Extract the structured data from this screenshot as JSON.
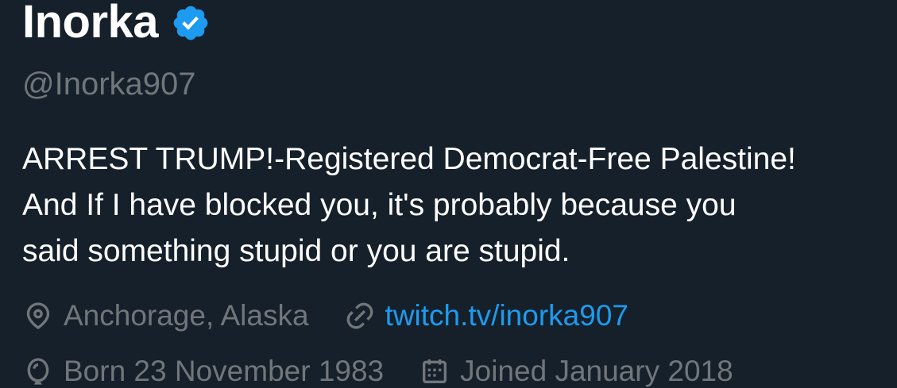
{
  "profile": {
    "display_name": "Inorka",
    "handle": "@Inorka907",
    "bio_lines": [
      "ARREST TRUMP!-Registered Democrat-Free Palestine!",
      "And If I have blocked you, it's probably because you",
      "said something stupid or you are stupid."
    ],
    "location": "Anchorage, Alaska",
    "website": "twitch.tv/inorka907",
    "birth_date": "Born 23 November 1983",
    "joined": "Joined January 2018"
  },
  "icons": {
    "verified": "verified-badge-icon",
    "location": "location-pin-icon",
    "link": "link-icon",
    "birthday": "balloon-icon",
    "calendar": "calendar-icon"
  },
  "colors": {
    "background": "#16202a",
    "name": "#ffffff",
    "secondary_text": "#71767b",
    "link": "#1d9bf0",
    "verified": "#1d9bf0"
  }
}
